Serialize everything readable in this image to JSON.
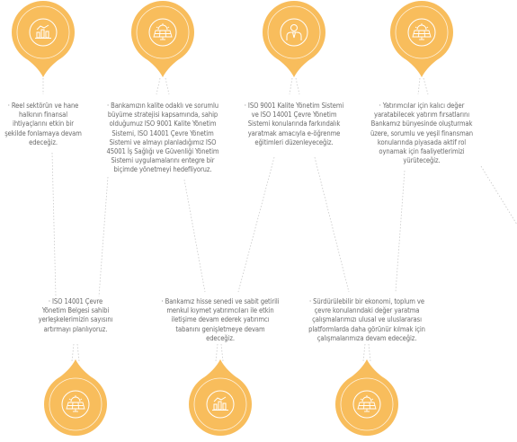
{
  "accent_color": "#f8bd5c",
  "top_items": [
    {
      "icon": "chart-icon",
      "text": "· Reel sektörün ve hane halkının finansal ihtiyaçlarını etkin bir şekilde fonlamaya devam edeceğiz."
    },
    {
      "icon": "solar-panel-icon",
      "text": "· Bankamızın kalite odaklı ve sorumlu büyüme stratejisi kapsamında, sahip olduğumuz ISO 9001 Kalite Yönetim Sistemi, ISO 14001 Çevre Yönetim Sistemi ve almayı planladığımız ISO 45001 İş Sağlığı ve Güvenliği Yönetim Sistemi uygulamalarını entegre bir biçimde yönetmeyi hedefliyoruz."
    },
    {
      "icon": "person-icon",
      "text": "· ISO 9001 Kalite Yönetim Sistemi ve ISO 14001 Çevre Yönetim Sistemi konularında farkındalık yaratmak amacıyla e-öğrenme eğitimleri düzenleyeceğiz."
    },
    {
      "icon": "solar-panel-icon",
      "text": "· Yatırımcılar için kalıcı değer yaratabilecek yatırım fırsatlarını Bankamız bünyesinde oluşturmak üzere, sorumlu ve yeşil finansman konularında piyasada aktif rol oynamak için faaliyetlerimizi yürüteceğiz."
    }
  ],
  "bottom_items": [
    {
      "icon": "solar-panel-icon",
      "text": "· ISO 14001 Çevre Yönetim Belgesi sahibi yerleşkelerimizin sayısını artırmayı planlıyoruz."
    },
    {
      "icon": "chart-icon",
      "text": "· Bankamız hisse senedi ve sabit getirili menkul kıymet yatırımcıları ile etkin iletişime devam ederek yatırımcı tabanını genişletmeye devam edeceğiz."
    },
    {
      "icon": "solar-panel-icon",
      "text": "· Sürdürülebilir bir ekonomi, toplum ve çevre konularındaki değer yaratma çalışmalarımızı ulusal ve uluslararası platformlarda daha görünür kılmak için çalışmalarımıza devam edeceğiz."
    }
  ]
}
